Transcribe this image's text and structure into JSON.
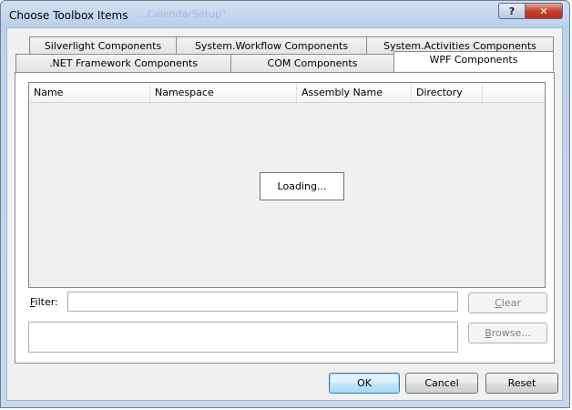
{
  "window": {
    "title": "Choose Toolbox Items",
    "ghost_title": "...CalendarSetup\"",
    "help_label": "?",
    "close_label": "✕"
  },
  "tabs": {
    "row_back": [
      {
        "label": "Silverlight Components"
      },
      {
        "label": "System.Workflow Components"
      },
      {
        "label": "System.Activities Components"
      }
    ],
    "row_front": [
      {
        "label": ".NET Framework Components"
      },
      {
        "label": "COM Components"
      },
      {
        "label": "WPF Components",
        "active": true
      }
    ]
  },
  "list": {
    "columns": [
      "Name",
      "Namespace",
      "Assembly Name",
      "Directory"
    ],
    "loading_text": "Loading..."
  },
  "filter": {
    "label_accel": "F",
    "label_rest": "ilter:",
    "value": "",
    "placeholder": ""
  },
  "buttons": {
    "clear": {
      "accel": "C",
      "rest": "lear"
    },
    "browse": {
      "accel": "B",
      "rest": "rowse..."
    },
    "ok": "OK",
    "cancel": "Cancel",
    "reset": "Reset"
  }
}
